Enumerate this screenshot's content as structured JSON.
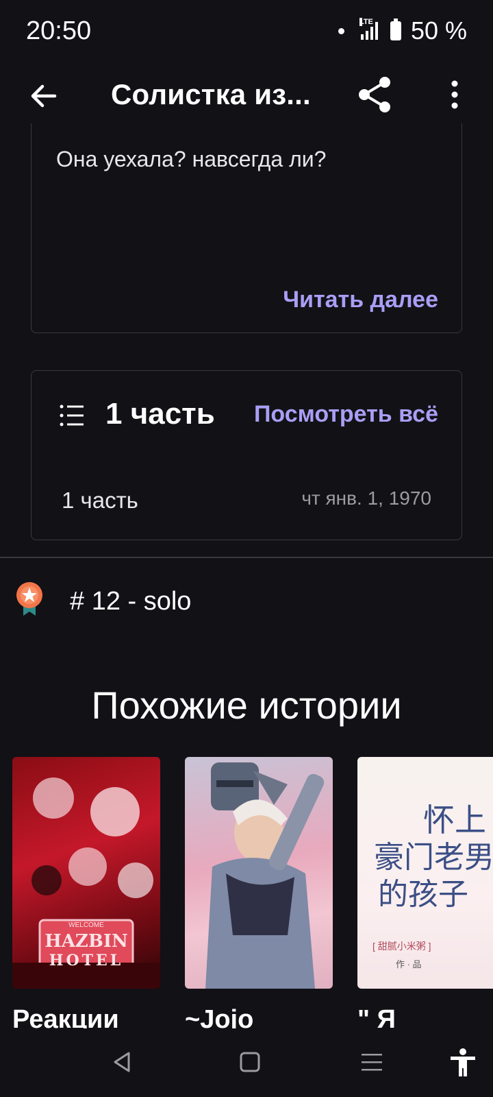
{
  "status": {
    "time": "20:50",
    "network": "LTE",
    "battery": "50 %"
  },
  "appbar": {
    "title": "Солистка из...",
    "back_icon": "arrow-left-icon",
    "share_icon": "share-icon",
    "more_icon": "more-vertical-icon"
  },
  "description": {
    "text": "Она уехала? навсегда ли?",
    "read_more": "Читать далее"
  },
  "parts": {
    "count_label": "1 часть",
    "view_all": "Посмотреть всё",
    "items": [
      {
        "name": "1 часть",
        "date": "чт янв. 1, 1970"
      }
    ]
  },
  "ranking": {
    "label": "# 12 - solo"
  },
  "similar": {
    "heading": "Похожие истории",
    "stories": [
      {
        "title": "Реакции",
        "cover_text_1": "HAZBIN",
        "cover_text_2": "HOTEL",
        "cover_text_3": "WELCOME"
      },
      {
        "title": "~Jojo"
      },
      {
        "title": "\" Я",
        "cover_text_1": "怀上",
        "cover_text_2": "豪门老男",
        "cover_text_3": "的孩子",
        "cover_text_4": "[ 甜腻小米粥 ]",
        "cover_text_5": "作 · 品"
      }
    ]
  },
  "colors": {
    "background": "#121116",
    "accent": "#a99ef5",
    "border": "#3a3940"
  }
}
